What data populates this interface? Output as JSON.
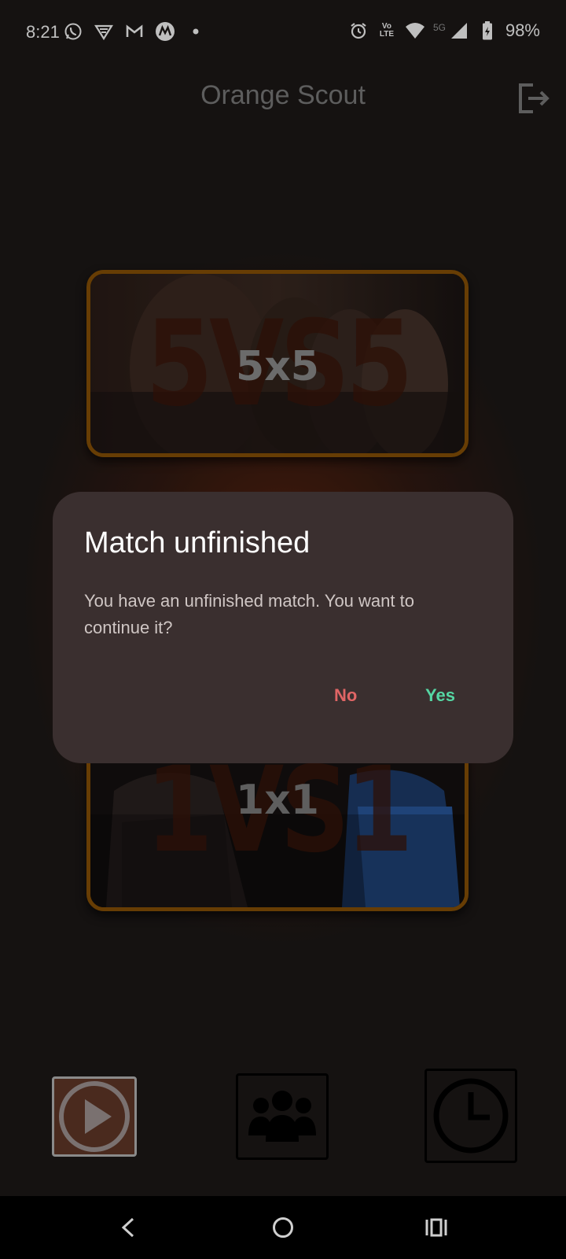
{
  "status_bar": {
    "time": "8:21",
    "battery": "98%",
    "network": "5G",
    "volte": "Vo LTE",
    "left_icons": [
      "whatsapp-icon",
      "vpn-icon",
      "gmail-icon",
      "motorola-icon",
      "dot-icon"
    ],
    "right_icons": [
      "alarm-icon",
      "volte-icon",
      "wifi-icon",
      "signal-icon",
      "battery-icon"
    ]
  },
  "app_bar": {
    "title": "Orange Scout",
    "action_icon": "logout-icon"
  },
  "modes": [
    {
      "label": "5x5",
      "background_text": "5VS5"
    },
    {
      "label": "1x1",
      "background_text": "1VS1"
    }
  ],
  "dialog": {
    "title": "Match unfinished",
    "message": "You have an unfinished match. You want to continue it?",
    "no_label": "No",
    "yes_label": "Yes",
    "no_color": "#e06565",
    "yes_color": "#55d6a3"
  },
  "bottom_nav": {
    "items": [
      {
        "icon": "play-icon",
        "selected": true
      },
      {
        "icon": "team-icon",
        "selected": false
      },
      {
        "icon": "clock-icon",
        "selected": false
      }
    ]
  },
  "colors": {
    "accent": "#8a5206",
    "background": "#1c1817",
    "dialog": "#3a2f2f"
  }
}
